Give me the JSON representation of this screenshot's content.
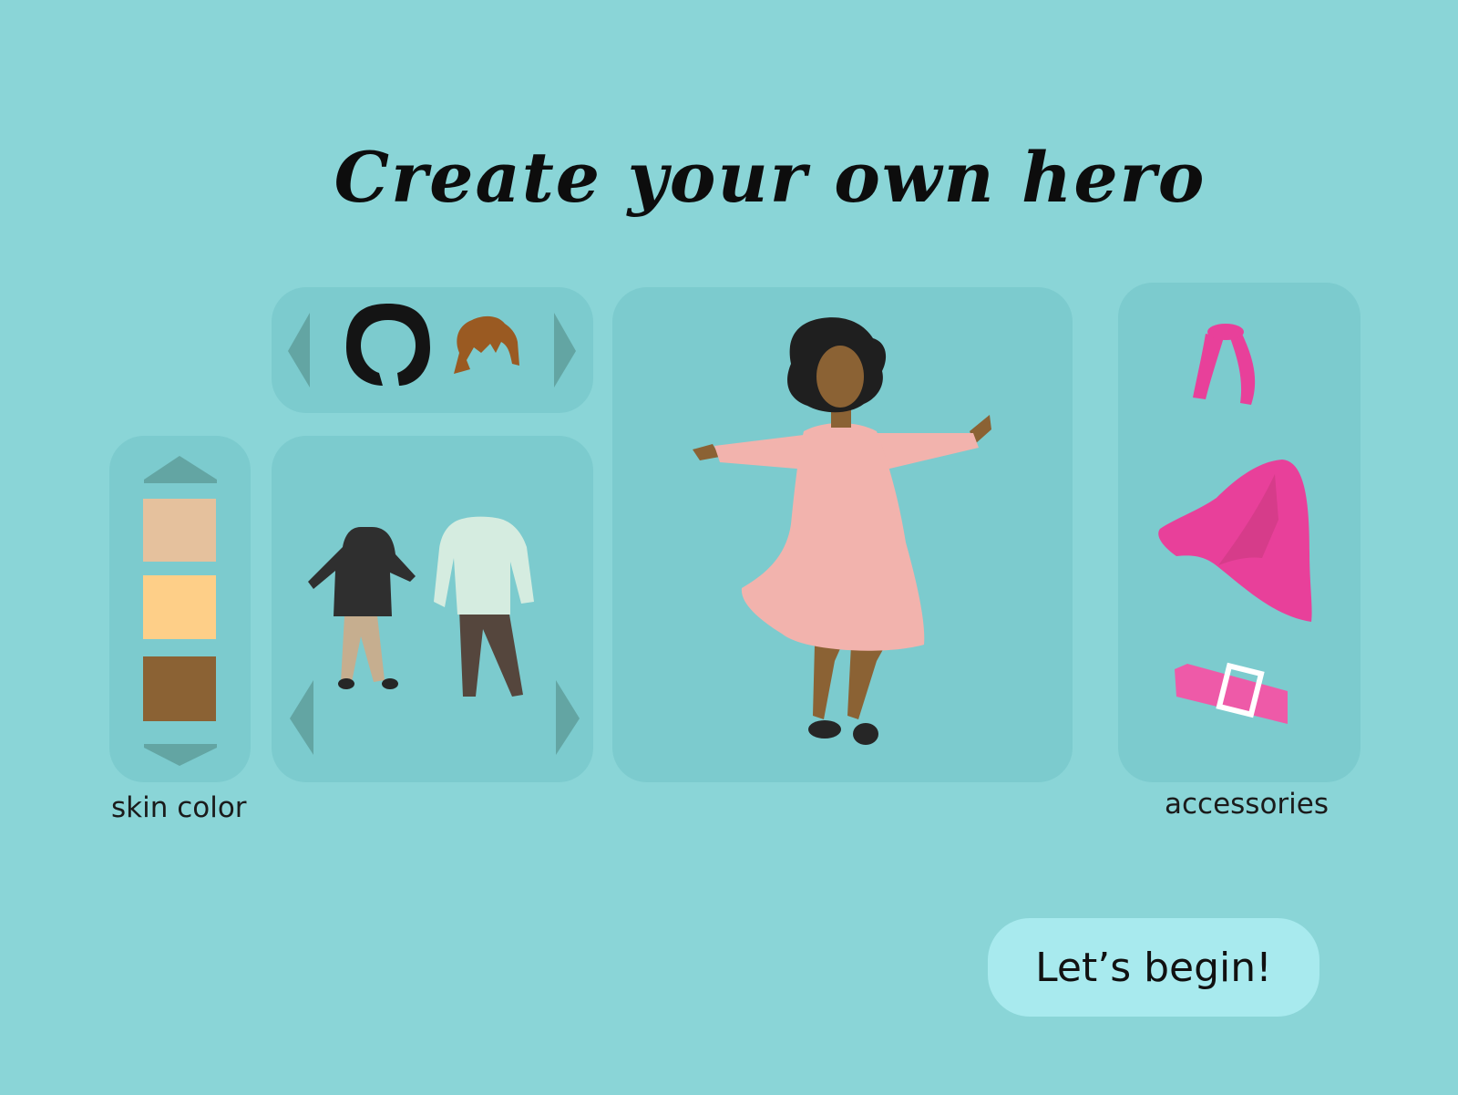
{
  "title": "Create your own hero",
  "labels": {
    "skin_color": "skin color",
    "accessories": "accessories"
  },
  "begin_button": "Let’s begin!",
  "skin_swatches": [
    {
      "name": "light-skin",
      "color": "#e5c19d"
    },
    {
      "name": "medium-skin",
      "color": "#fecf88"
    },
    {
      "name": "dark-skin",
      "color": "#8b6234"
    }
  ],
  "colors": {
    "background": "#8ad5d7",
    "panel": "#7ccbce",
    "arrow": "#63a5a3",
    "button": "#a8eaee",
    "accent_pink": "#e8409a",
    "dress": "#f2b3ad"
  },
  "icons": {
    "hair_options": [
      "black-bob-hair-icon",
      "brown-spiky-hair-icon"
    ],
    "outfit_options": [
      "black-shirt-beige-pants-icon",
      "white-shirt-brown-pants-icon"
    ],
    "accessory_options": [
      "pink-headband-icon",
      "pink-cape-icon",
      "pink-belt-icon"
    ],
    "arrows": [
      "chevron-up-icon",
      "chevron-down-icon",
      "chevron-left-icon",
      "chevron-right-icon"
    ]
  }
}
